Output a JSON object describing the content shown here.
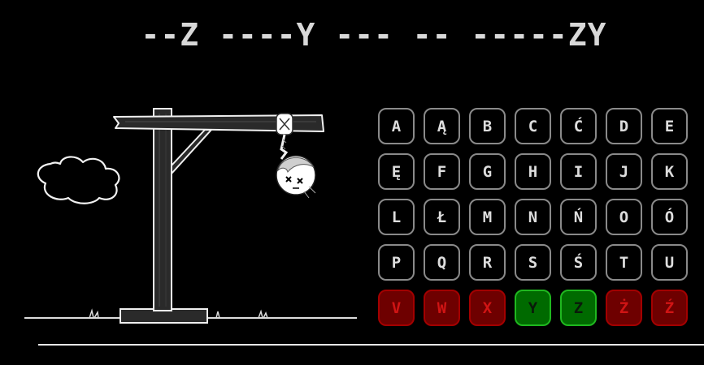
{
  "puzzle": {
    "masked_word": "--Z ----Y --- -- -----ZY"
  },
  "keyboard": {
    "keys": [
      {
        "letter": "A",
        "state": "unused"
      },
      {
        "letter": "Ą",
        "state": "unused"
      },
      {
        "letter": "B",
        "state": "unused"
      },
      {
        "letter": "C",
        "state": "unused"
      },
      {
        "letter": "Ć",
        "state": "unused"
      },
      {
        "letter": "D",
        "state": "unused"
      },
      {
        "letter": "E",
        "state": "unused"
      },
      {
        "letter": "Ę",
        "state": "unused"
      },
      {
        "letter": "F",
        "state": "unused"
      },
      {
        "letter": "G",
        "state": "unused"
      },
      {
        "letter": "H",
        "state": "unused"
      },
      {
        "letter": "I",
        "state": "unused"
      },
      {
        "letter": "J",
        "state": "unused"
      },
      {
        "letter": "K",
        "state": "unused"
      },
      {
        "letter": "L",
        "state": "unused"
      },
      {
        "letter": "Ł",
        "state": "unused"
      },
      {
        "letter": "M",
        "state": "unused"
      },
      {
        "letter": "N",
        "state": "unused"
      },
      {
        "letter": "Ń",
        "state": "unused"
      },
      {
        "letter": "O",
        "state": "unused"
      },
      {
        "letter": "Ó",
        "state": "unused"
      },
      {
        "letter": "P",
        "state": "unused"
      },
      {
        "letter": "Q",
        "state": "unused"
      },
      {
        "letter": "R",
        "state": "unused"
      },
      {
        "letter": "S",
        "state": "unused"
      },
      {
        "letter": "Ś",
        "state": "unused"
      },
      {
        "letter": "T",
        "state": "unused"
      },
      {
        "letter": "U",
        "state": "unused"
      },
      {
        "letter": "V",
        "state": "wrong"
      },
      {
        "letter": "W",
        "state": "wrong"
      },
      {
        "letter": "X",
        "state": "wrong"
      },
      {
        "letter": "Y",
        "state": "correct"
      },
      {
        "letter": "Z",
        "state": "correct"
      },
      {
        "letter": "Ż",
        "state": "wrong"
      },
      {
        "letter": "Ź",
        "state": "wrong"
      }
    ]
  },
  "colors": {
    "background": "#000000",
    "key_border": "#8a8a8a",
    "wrong_fill": "#6e0000",
    "wrong_text": "#d01414",
    "correct_fill": "#006a00",
    "correct_border": "#1fb81f"
  },
  "hangman": {
    "mistakes_shown": 5,
    "parts_drawn": [
      "ground",
      "post",
      "beam",
      "brace",
      "rope",
      "head"
    ]
  }
}
